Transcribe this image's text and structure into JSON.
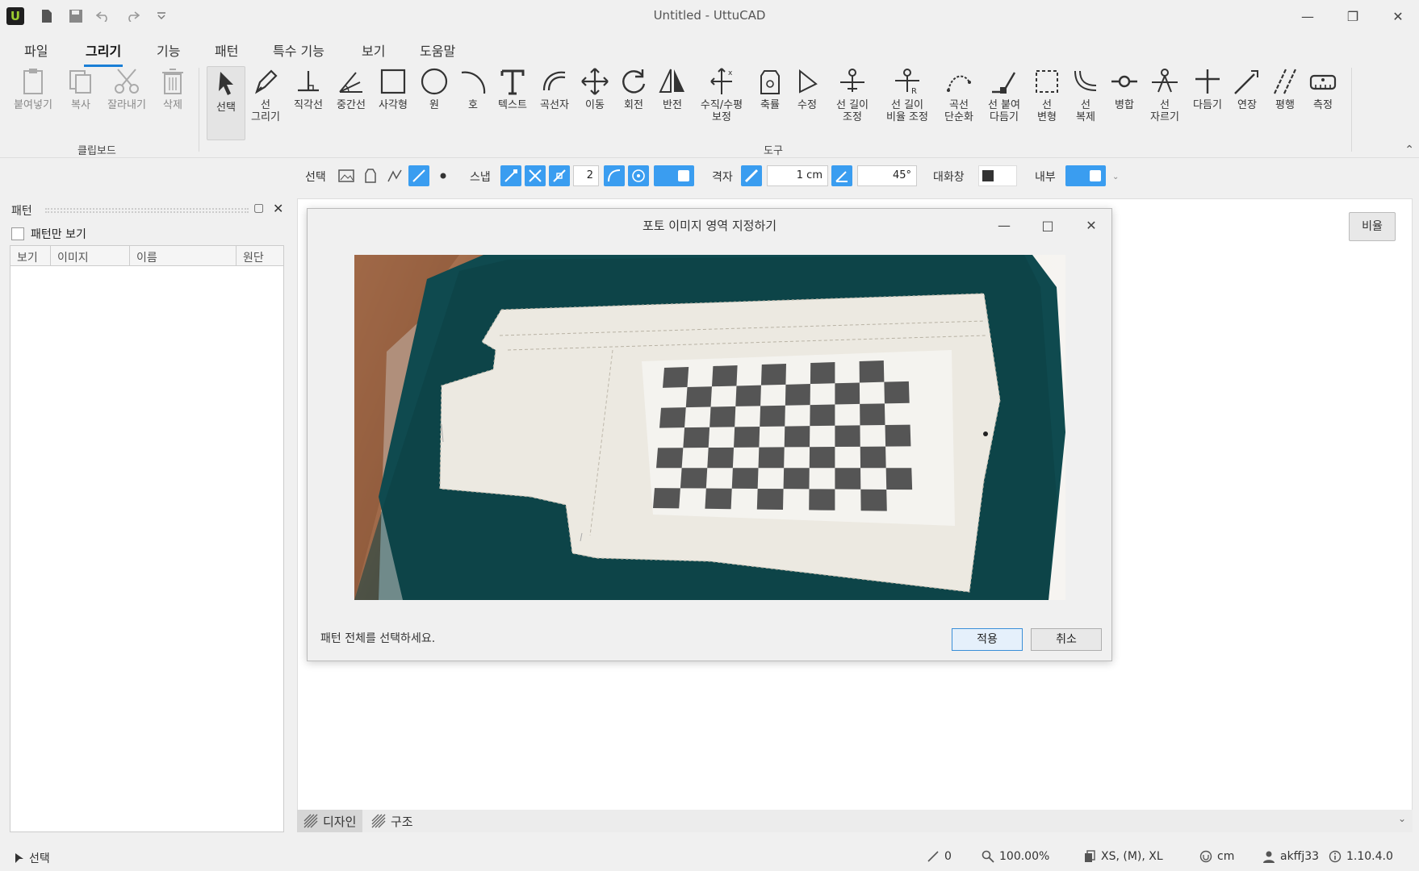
{
  "window": {
    "title": "Untitled - UttuCAD",
    "logo": "U"
  },
  "menus": [
    "파일",
    "그리기",
    "기능",
    "패턴",
    "특수 기능",
    "보기",
    "도움말"
  ],
  "active_menu": "그리기",
  "ribbon": {
    "clipboard": {
      "label": "클립보드",
      "tools": [
        "붙여넣기",
        "복사",
        "잘라내기",
        "삭제"
      ]
    },
    "tools_group_label": "도구",
    "tools": [
      {
        "line1": "선택",
        "line2": ""
      },
      {
        "line1": "선",
        "line2": "그리기"
      },
      {
        "line1": "직각선",
        "line2": ""
      },
      {
        "line1": "중간선",
        "line2": ""
      },
      {
        "line1": "사각형",
        "line2": ""
      },
      {
        "line1": "원",
        "line2": ""
      },
      {
        "line1": "호",
        "line2": ""
      },
      {
        "line1": "텍스트",
        "line2": ""
      },
      {
        "line1": "곡선자",
        "line2": ""
      },
      {
        "line1": "이동",
        "line2": ""
      },
      {
        "line1": "회전",
        "line2": ""
      },
      {
        "line1": "반전",
        "line2": ""
      },
      {
        "line1": "수직/수평",
        "line2": "보정"
      },
      {
        "line1": "축률",
        "line2": ""
      },
      {
        "line1": "수정",
        "line2": ""
      },
      {
        "line1": "선 길이",
        "line2": "조정"
      },
      {
        "line1": "선 길이",
        "line2": "비율 조정"
      },
      {
        "line1": "곡선",
        "line2": "단순화"
      },
      {
        "line1": "선 붙여",
        "line2": "다듬기"
      },
      {
        "line1": "선",
        "line2": "변형"
      },
      {
        "line1": "선",
        "line2": "복제"
      },
      {
        "line1": "병합",
        "line2": ""
      },
      {
        "line1": "선",
        "line2": "자르기"
      },
      {
        "line1": "다듬기",
        "line2": ""
      },
      {
        "line1": "연장",
        "line2": ""
      },
      {
        "line1": "평행",
        "line2": ""
      },
      {
        "line1": "측정",
        "line2": ""
      }
    ]
  },
  "options": {
    "select_label": "선택",
    "snap_label": "스냅",
    "snap_count": "2",
    "grid_label": "격자",
    "grid_value": "1 cm",
    "angle_value": "45°",
    "dialog_label": "대화창",
    "inner_label": "내부"
  },
  "panel": {
    "title": "패턴",
    "checkbox_label": "패턴만 보기",
    "columns": [
      "보기",
      "이미지",
      "이름",
      "원단"
    ]
  },
  "canvas": {
    "ratio_button": "비율"
  },
  "bottom_tabs": [
    "디자인",
    "구조"
  ],
  "dialog": {
    "title": "포토 이미지 영역 지정하기",
    "message": "패턴 전체를 선택하세요.",
    "apply": "적용",
    "cancel": "취소"
  },
  "status": {
    "mode": "선택",
    "line_count": "0",
    "zoom": "100.00%",
    "sizes": "XS, (M), XL",
    "unit": "cm",
    "user": "akffj33",
    "version": "1.10.4.0"
  },
  "colors": {
    "accent": "#1a7fd6",
    "toggle": "#3a9df0",
    "fabric": "#0f4a4f",
    "checker": "#555555"
  }
}
